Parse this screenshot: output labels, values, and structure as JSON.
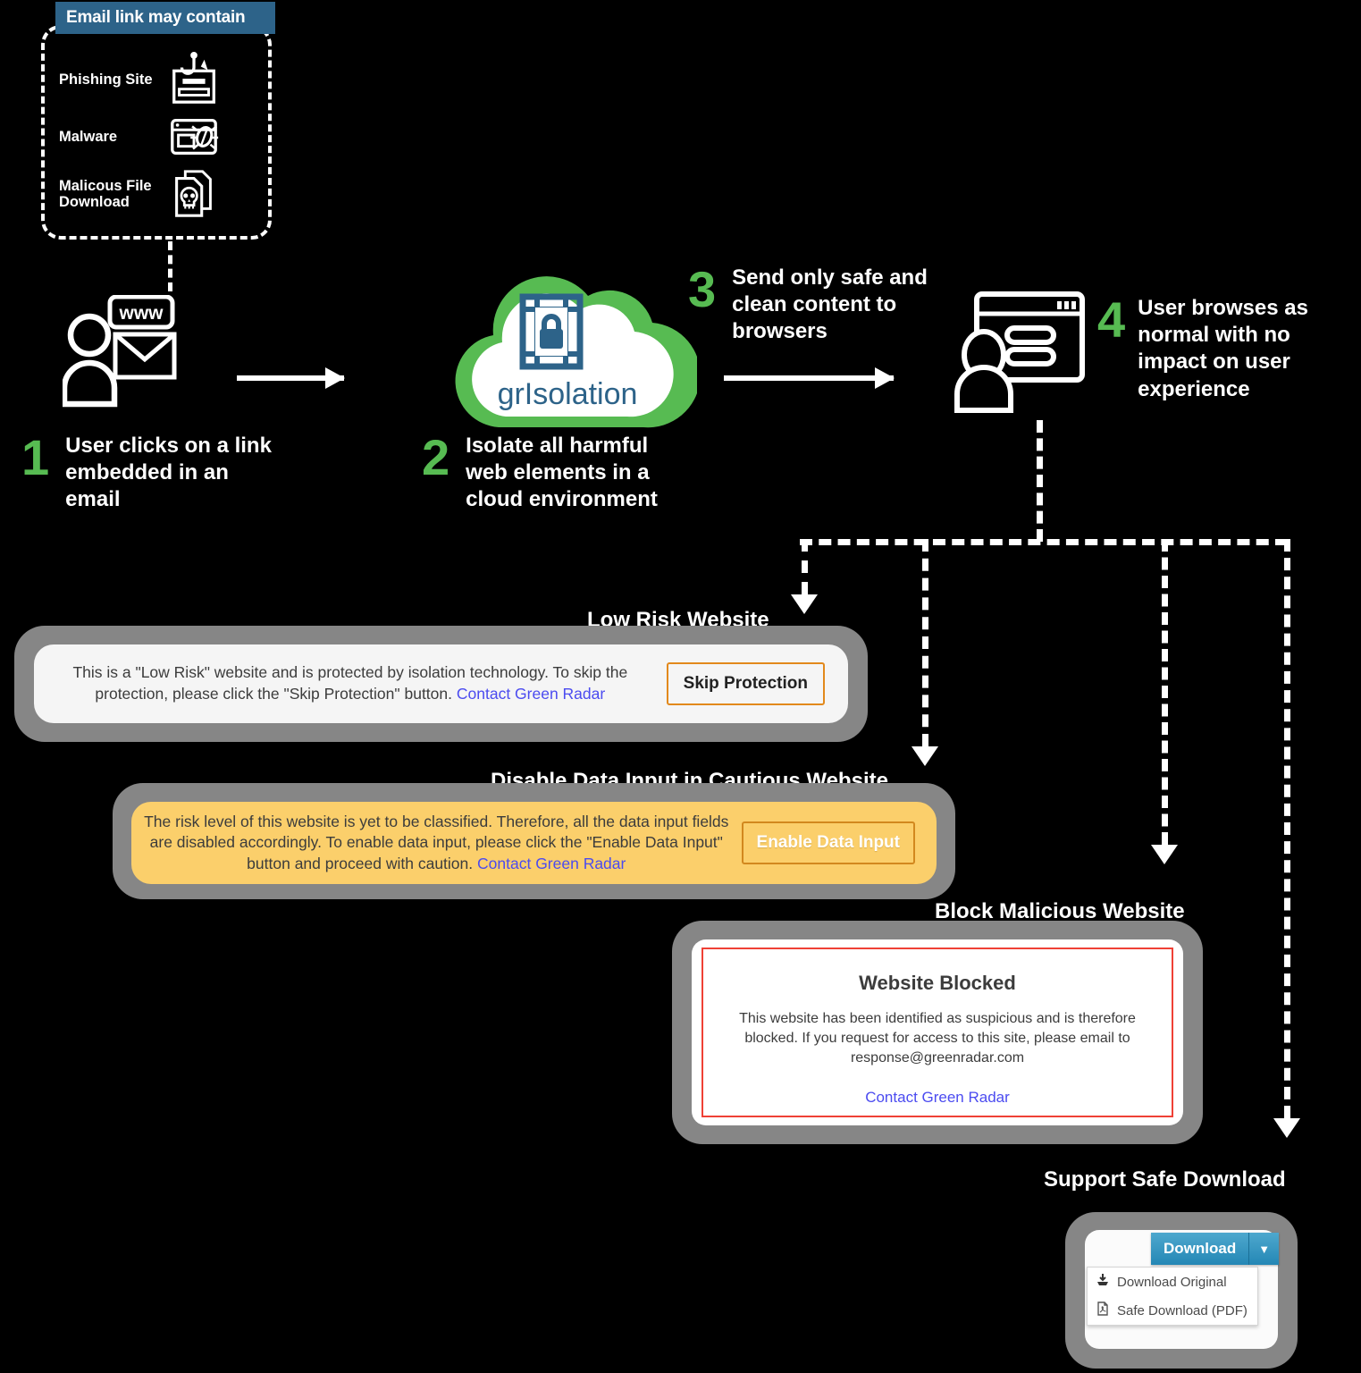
{
  "threat_box": {
    "header": "Email link may contain",
    "items": [
      {
        "label": "Phishing Site",
        "icon": "phishing-login-hook-icon"
      },
      {
        "label": "Malware",
        "icon": "browser-bug-icon"
      },
      {
        "label": "Malicous File Download",
        "icon": "skull-document-icon"
      }
    ]
  },
  "steps": [
    {
      "number": "1",
      "caption": "User clicks on a link embedded in an email"
    },
    {
      "number": "2",
      "caption": "Isolate all harmful web elements in a cloud environment"
    },
    {
      "number": "3",
      "caption": "Send only safe and clean content to browsers"
    },
    {
      "number": "4",
      "caption": "User browses as normal with no impact on user experience"
    }
  ],
  "cloud": {
    "brand": "grIsolation",
    "icon": "lock-in-prison-bars-icon",
    "cloud_color": "#57bb52",
    "brand_color": "#2d6389"
  },
  "icons": {
    "user_email": "user-with-www-envelope-icon",
    "user_browser": "user-with-browser-window-icon"
  },
  "low_risk": {
    "title": "Low Risk Website",
    "message_part1": "This is a \"Low Risk\" website and is protected by isolation technology. To skip the protection, please click the \"Skip Protection\" button.",
    "link": "Contact Green Radar",
    "button": "Skip Protection",
    "button_border_color": "#e2891c",
    "background": "#f5f5f5"
  },
  "cautious": {
    "title": "Disable Data Input in Cautious Website",
    "message_part1": "The risk level of this website is yet to be classified. Therefore, all the data input fields are disabled accordingly. To enable data input, please click the \"Enable Data Input\" button and proceed with caution.",
    "link": "Contact Green Radar",
    "button": "Enable Data Input",
    "background": "#fbcf6b"
  },
  "blocked": {
    "title": "Block Malicious Website",
    "heading": "Website Blocked",
    "body": "This website has been identified as suspicious and is therefore blocked. If you request for access to this site, please email to response@greenradar.com",
    "link": "Contact Green Radar",
    "border_color": "#ef4136"
  },
  "download": {
    "title": "Support Safe Download",
    "button": "Download",
    "caret": "▼",
    "menu": [
      {
        "label": "Download Original",
        "icon": "download-arrow-tray-icon"
      },
      {
        "label": "Safe Download (PDF)",
        "icon": "pdf-file-icon"
      }
    ],
    "button_color": "#2487b5"
  }
}
